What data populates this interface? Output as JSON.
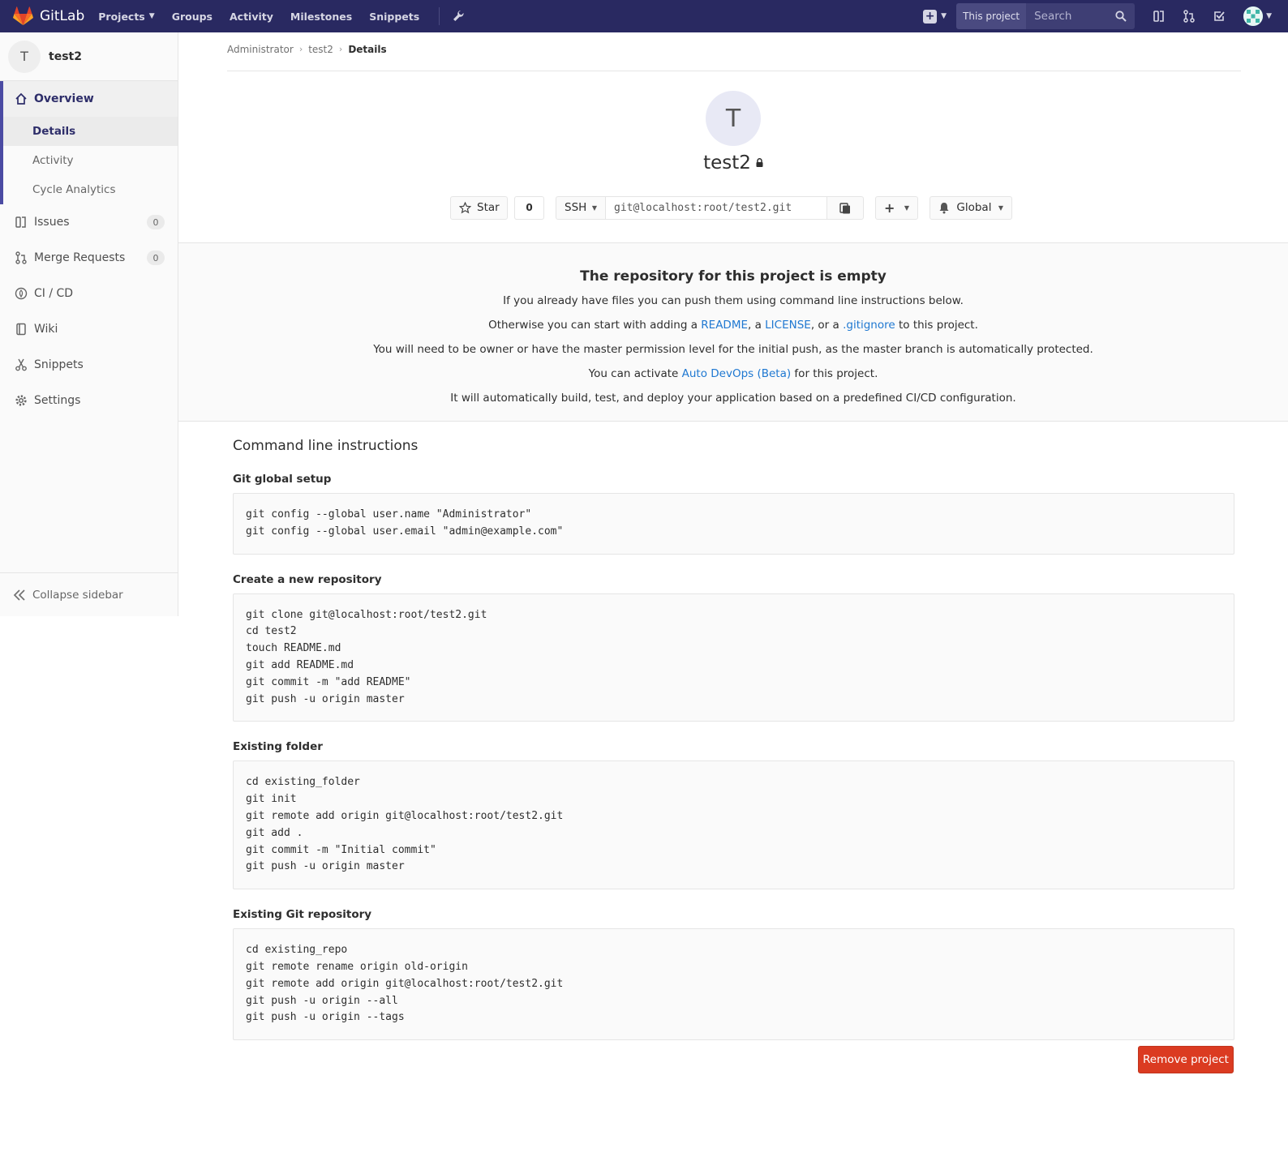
{
  "navbar": {
    "brand": "GitLab",
    "links": [
      {
        "label": "Projects",
        "has_caret": true
      },
      {
        "label": "Groups"
      },
      {
        "label": "Activity"
      },
      {
        "label": "Milestones"
      },
      {
        "label": "Snippets"
      }
    ],
    "search_scope": "This project",
    "search_placeholder": "Search",
    "colors": {
      "navbar_bg": "#292961",
      "accent": "#4b4ba3",
      "danger": "#db3b21",
      "link": "#1f78d1"
    }
  },
  "sidebar": {
    "project_initial": "T",
    "project_name": "test2",
    "overview_label": "Overview",
    "overview_subitems": [
      {
        "label": "Details",
        "active": true
      },
      {
        "label": "Activity"
      },
      {
        "label": "Cycle Analytics"
      }
    ],
    "items": [
      {
        "label": "Issues",
        "icon": "issues-icon",
        "badge": "0"
      },
      {
        "label": "Merge Requests",
        "icon": "merge-request-icon",
        "badge": "0"
      },
      {
        "label": "CI / CD",
        "icon": "rocket-icon"
      },
      {
        "label": "Wiki",
        "icon": "book-icon"
      },
      {
        "label": "Snippets",
        "icon": "scissors-icon"
      },
      {
        "label": "Settings",
        "icon": "gear-icon"
      }
    ],
    "collapse_label": "Collapse sidebar"
  },
  "breadcrumb": [
    "Administrator",
    "test2",
    "Details"
  ],
  "project": {
    "initial": "T",
    "name": "test2",
    "star_label": "Star",
    "star_count": "0",
    "clone_protocol": "SSH",
    "clone_url": "git@localhost:root/test2.git",
    "notification_level": "Global"
  },
  "empty_repo": {
    "title": "The repository for this project is empty",
    "line1": "If you already have files you can push them using command line instructions below.",
    "line2_pre": "Otherwise you can start with adding a ",
    "line2_readme": "README",
    "line2_mid1": ", a ",
    "line2_license": "LICENSE",
    "line2_mid2": ", or a ",
    "line2_gitignore": ".gitignore",
    "line2_post": " to this project.",
    "line3": "You will need to be owner or have the master permission level for the initial push, as the master branch is automatically protected.",
    "line4_pre": "You can activate ",
    "line4_link": "Auto DevOps (Beta)",
    "line4_post": " for this project.",
    "line5": "It will automatically build, test, and deploy your application based on a predefined CI/CD configuration."
  },
  "cli": {
    "title": "Command line instructions",
    "sections": [
      {
        "heading": "Git global setup",
        "code": "git config --global user.name \"Administrator\"\ngit config --global user.email \"admin@example.com\""
      },
      {
        "heading": "Create a new repository",
        "code": "git clone git@localhost:root/test2.git\ncd test2\ntouch README.md\ngit add README.md\ngit commit -m \"add README\"\ngit push -u origin master"
      },
      {
        "heading": "Existing folder",
        "code": "cd existing_folder\ngit init\ngit remote add origin git@localhost:root/test2.git\ngit add .\ngit commit -m \"Initial commit\"\ngit push -u origin master"
      },
      {
        "heading": "Existing Git repository",
        "code": "cd existing_repo\ngit remote rename origin old-origin\ngit remote add origin git@localhost:root/test2.git\ngit push -u origin --all\ngit push -u origin --tags"
      }
    ]
  },
  "remove_label": "Remove project"
}
